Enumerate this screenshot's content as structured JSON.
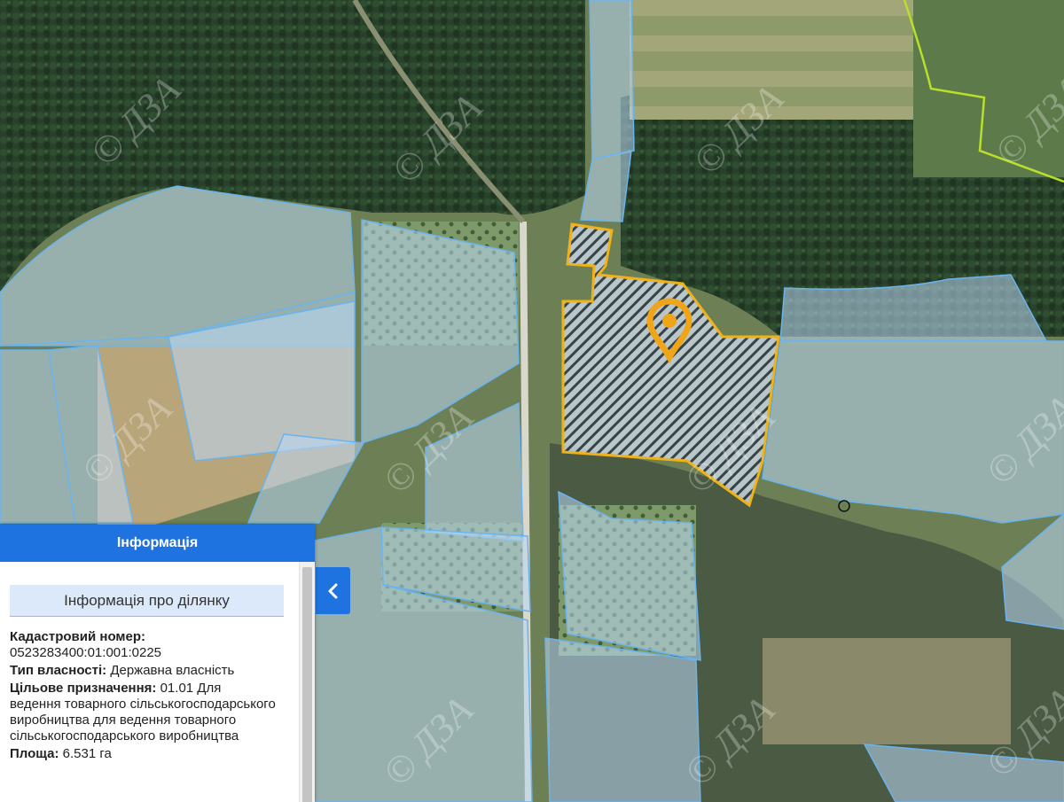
{
  "map": {
    "watermark": "© ДЗА",
    "colors": {
      "parcel_fill": "#bcd9f5",
      "parcel_stroke": "#6ab4ee",
      "selected_stroke": "#f0b21b",
      "marker": "#f0a418",
      "boundary": "#b8e02a"
    },
    "marker_icon": "map-pin-icon"
  },
  "panel": {
    "header": "Інформація",
    "section_title": "Інформація про ділянку",
    "fields": [
      {
        "label": "Кадастровий номер:",
        "value": "0523283400:01:001:0225"
      },
      {
        "label": "Тип власності:",
        "value": "Державна власність"
      },
      {
        "label": "Цільове призначення:",
        "value": "01.01 Для ведення товарного сільськогосподарського виробництва для ведення товарного сільськогосподарського виробництва"
      },
      {
        "label": "Площа:",
        "value": "6.531 га"
      }
    ],
    "collapse_icon": "chevron-left-icon"
  }
}
